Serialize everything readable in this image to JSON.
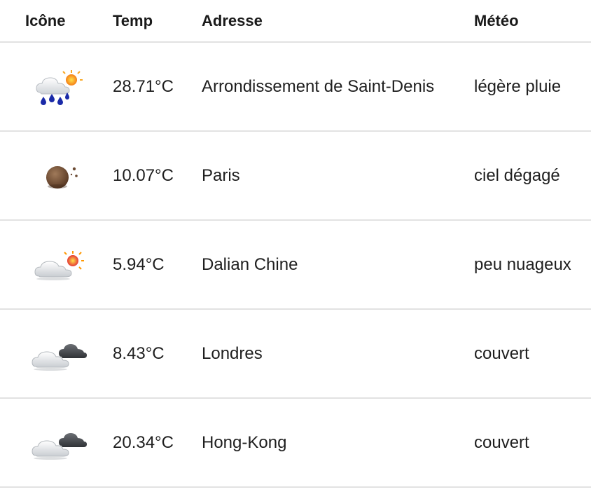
{
  "table": {
    "headers": {
      "icon": "Icône",
      "temp": "Temp",
      "address": "Adresse",
      "weather": "Météo"
    },
    "rows": [
      {
        "icon": "rain-sun-icon",
        "temp": "28.71°C",
        "address": "Arrondissement de Saint-Denis",
        "weather": "légère pluie"
      },
      {
        "icon": "clear-night-icon",
        "temp": "10.07°C",
        "address": "Paris",
        "weather": "ciel dégagé"
      },
      {
        "icon": "cloud-sun-icon",
        "temp": "5.94°C",
        "address": "Dalian Chine",
        "weather": "peu nuageux"
      },
      {
        "icon": "overcast-icon",
        "temp": "8.43°C",
        "address": "Londres",
        "weather": "couvert"
      },
      {
        "icon": "overcast-icon",
        "temp": "20.34°C",
        "address": "Hong-Kong",
        "weather": "couvert"
      }
    ]
  }
}
